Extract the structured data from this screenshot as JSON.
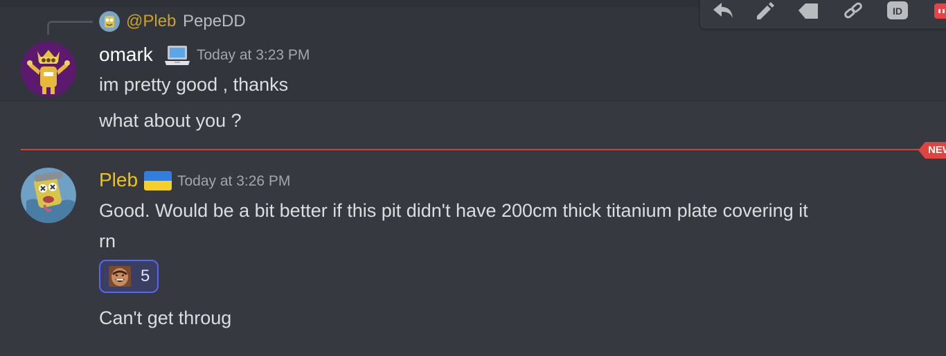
{
  "toolbar": {
    "actions": [
      "reply-icon",
      "edit-icon",
      "tag-icon",
      "copy-link-icon",
      "copy-id-icon",
      "more-icon"
    ],
    "id_label": "ID"
  },
  "reply": {
    "author": "@Pleb",
    "preview": "PepeDD"
  },
  "message_1": {
    "author": "omark",
    "author_color": "#ffffff",
    "badge": "laptop-icon",
    "timestamp": "Today at 3:23 PM",
    "lines": [
      "im pretty good , thanks",
      "what about you ?"
    ]
  },
  "divider": {
    "label": "NEW",
    "color": "#ed4245"
  },
  "message_2": {
    "author": "Pleb",
    "author_color": "#f1c40f",
    "badge": "ukraine-flag-icon",
    "timestamp": "Today at 3:26 PM",
    "lines": [
      "Good. Would be a bit better if this pit didn't have 200cm thick titanium plate covering it",
      "rn"
    ],
    "reaction": {
      "emoji": "laughing-face-emoji",
      "count": "5"
    },
    "followup": "Can't get throug"
  }
}
